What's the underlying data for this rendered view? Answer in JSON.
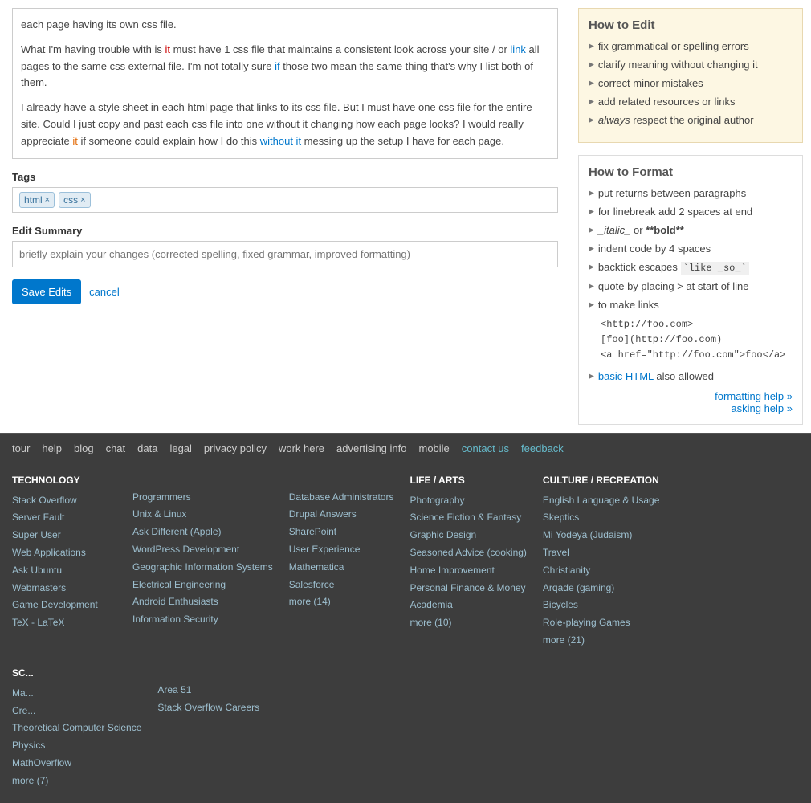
{
  "question_text": {
    "para1_parts": [
      {
        "text": "each page having its own css file.",
        "type": "normal"
      }
    ],
    "para2_parts": [
      {
        "text": "What I'm having trouble with is ",
        "type": "normal"
      },
      {
        "text": "it",
        "type": "red"
      },
      {
        "text": " must have 1 css file that maintains a consistent look across your site / or ",
        "type": "normal"
      },
      {
        "text": "link",
        "type": "blue"
      },
      {
        "text": " all pages to the same css external file. I'm not totally sure ",
        "type": "normal"
      },
      {
        "text": "if",
        "type": "blue"
      },
      {
        "text": " those two mean the same thing that's why I list both of them.",
        "type": "normal"
      }
    ],
    "para3_parts": [
      {
        "text": "I already have a style sheet in each html page that links to its css file. But I must have one css file for the entire site. Could I just copy and past each css file into one without it changing how each page looks? I would really appreciate ",
        "type": "normal"
      },
      {
        "text": "it",
        "type": "orange"
      },
      {
        "text": " if someone could explain how I do this ",
        "type": "normal"
      },
      {
        "text": "without it",
        "type": "blue"
      },
      {
        "text": " messing up the setup I have for each page.",
        "type": "normal"
      }
    ]
  },
  "tags": {
    "label": "Tags",
    "items": [
      {
        "name": "html"
      },
      {
        "name": "css"
      }
    ]
  },
  "edit_summary": {
    "label": "Edit Summary",
    "placeholder": "briefly explain your changes (corrected spelling, fixed grammar, improved formatting)"
  },
  "buttons": {
    "save": "Save Edits",
    "cancel": "cancel"
  },
  "footer_nav": {
    "links": [
      {
        "text": "tour",
        "highlight": false
      },
      {
        "text": "help",
        "highlight": false
      },
      {
        "text": "blog",
        "highlight": false
      },
      {
        "text": "chat",
        "highlight": false
      },
      {
        "text": "data",
        "highlight": false
      },
      {
        "text": "legal",
        "highlight": false
      },
      {
        "text": "privacy policy",
        "highlight": false
      },
      {
        "text": "work here",
        "highlight": false
      },
      {
        "text": "advertising info",
        "highlight": false
      },
      {
        "text": "mobile",
        "highlight": false
      },
      {
        "text": "contact us",
        "highlight": true
      },
      {
        "text": "feedback",
        "highlight": true
      }
    ]
  },
  "footer_columns": [
    {
      "header": "TECHNOLOGY",
      "links_col1": [
        "Stack Overflow",
        "Server Fault",
        "Super User",
        "Web Applications",
        "Ask Ubuntu",
        "Webmasters",
        "Game Development",
        "TeX - LaTeX"
      ],
      "links_col2": [
        "Programmers",
        "Unix & Linux",
        "Ask Different (Apple)",
        "WordPress Development",
        "Geographic Information Systems",
        "Electrical Engineering",
        "Android Enthusiasts",
        "Information Security"
      ],
      "links_col3": [
        "Database Administrators",
        "Drupal Answers",
        "SharePoint",
        "User Experience",
        "Mathematica",
        "Salesforce",
        "more (14)"
      ]
    },
    {
      "header": "LIFE / ARTS",
      "links": [
        "Photography",
        "Science Fiction & Fantasy",
        "Graphic Design",
        "Seasoned Advice (cooking)",
        "Home Improvement",
        "Personal Finance & Money",
        "Academia",
        "more (10)"
      ]
    },
    {
      "header": "CULTURE / RECREATION",
      "links": [
        "English Language & Usage",
        "Skeptics",
        "Mi Yodeya (Judaism)",
        "Travel",
        "Christianity",
        "Arqade (gaming)",
        "Bicycles",
        "Role-playing Games",
        "more (21)"
      ]
    },
    {
      "header": "SC...",
      "links_col1": [
        "Ma...",
        "Cre...",
        "Theoretical Computer Science",
        "Physics",
        "MathOverflow",
        "more (7)"
      ],
      "links_col2": [
        "Area 51",
        "Stack Overflow Careers"
      ]
    }
  ],
  "how_to_edit": {
    "title": "How to Edit",
    "items": [
      "fix grammatical or spelling errors",
      "clarify meaning without changing it",
      "correct minor mistakes",
      "add related resources or links",
      "always respect the original author"
    ],
    "italic_item_index": 4,
    "italic_word": "always"
  },
  "how_to_format": {
    "title": "How to Format",
    "items": [
      {
        "text": "put returns between paragraphs",
        "code": null
      },
      {
        "text": "for linebreak add 2 spaces at end",
        "code": null
      },
      {
        "text": "_italic_ or **bold**",
        "code": null,
        "has_format": true
      },
      {
        "text": "indent code by 4 spaces",
        "code": null
      },
      {
        "text": "backtick escapes ",
        "code": "`like _so_`"
      },
      {
        "text": "quote by placing > at start of line",
        "code": null
      },
      {
        "text": "to make links",
        "code": null
      },
      {
        "text": "<http://foo.com>\n[foo](http://foo.com)\n<a href=\"http://foo.com\">foo</a>",
        "code": null,
        "is_block": true
      },
      {
        "text": "basic HTML also allowed",
        "code": null,
        "is_html_link": true
      }
    ],
    "formatting_help": "formatting help »",
    "asking_help": "asking help »"
  }
}
